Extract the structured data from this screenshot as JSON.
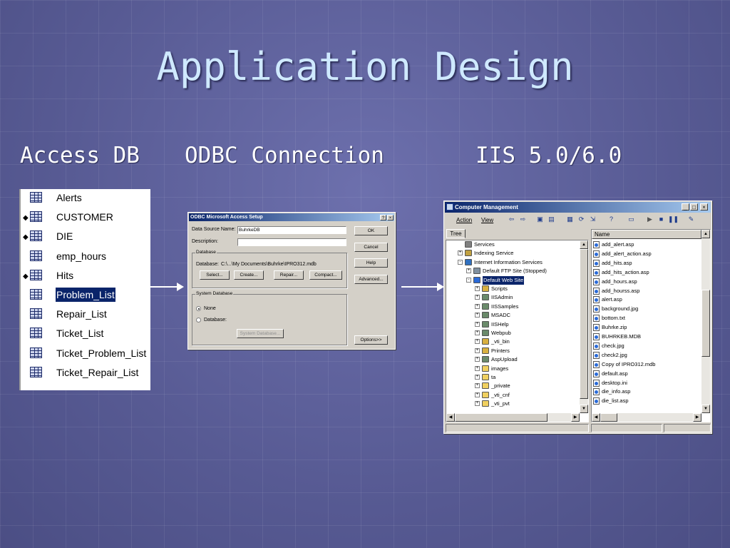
{
  "slide": {
    "title": "Application Design",
    "label_access": "Access DB",
    "label_odbc": "ODBC Connection",
    "label_iis": "IIS 5.0/6.0"
  },
  "access_tables": [
    {
      "name": "Alerts",
      "key": false,
      "selected": false
    },
    {
      "name": "CUSTOMER",
      "key": true,
      "selected": false
    },
    {
      "name": "DIE",
      "key": true,
      "selected": false
    },
    {
      "name": "emp_hours",
      "key": false,
      "selected": false
    },
    {
      "name": "Hits",
      "key": true,
      "selected": false
    },
    {
      "name": "Problem_List",
      "key": false,
      "selected": true
    },
    {
      "name": "Repair_List",
      "key": false,
      "selected": false
    },
    {
      "name": "Ticket_List",
      "key": false,
      "selected": false
    },
    {
      "name": "Ticket_Problem_List",
      "key": false,
      "selected": false
    },
    {
      "name": "Ticket_Repair_List",
      "key": false,
      "selected": false
    }
  ],
  "odbc": {
    "title": "ODBC Microsoft Access Setup",
    "help_btn": "?",
    "close_btn": "×",
    "dsn_label": "Data Source Name:",
    "dsn_value": "BuhrkeDB",
    "desc_label": "Description:",
    "desc_value": "",
    "db_group": "Database",
    "db_path_label": "Database:",
    "db_path": "C:\\...\\My Documents\\Buhrke\\IPRO312.mdb",
    "select": "Select...",
    "create": "Create...",
    "repair": "Repair...",
    "compact": "Compact...",
    "sysdb_group": "System Database",
    "none": "None",
    "database": "Database:",
    "sysdb_btn": "System Database...",
    "ok": "OK",
    "cancel": "Cancel",
    "help": "Help",
    "advanced": "Advanced...",
    "options": "Options>>"
  },
  "cm": {
    "title": "Computer Management",
    "menu_action": "Action",
    "menu_view": "View",
    "tab_tree": "Tree",
    "col_name": "Name",
    "tree": [
      {
        "text": "Services",
        "indent": 1,
        "pm": "",
        "icon": "gear",
        "selected": false
      },
      {
        "text": "Indexing Service",
        "indent": 1,
        "pm": "+",
        "icon": "service",
        "selected": false
      },
      {
        "text": "Internet Information Services",
        "indent": 1,
        "pm": "-",
        "icon": "iis",
        "selected": false
      },
      {
        "text": "Default FTP Site (Stopped)",
        "indent": 2,
        "pm": "+",
        "icon": "ftp",
        "selected": false
      },
      {
        "text": "Default Web Site",
        "indent": 2,
        "pm": "-",
        "icon": "globe",
        "selected": true
      },
      {
        "text": "Scripts",
        "indent": 3,
        "pm": "+",
        "icon": "vdir",
        "selected": false
      },
      {
        "text": "IISAdmin",
        "indent": 3,
        "pm": "+",
        "icon": "app",
        "selected": false
      },
      {
        "text": "IISSamples",
        "indent": 3,
        "pm": "+",
        "icon": "app",
        "selected": false
      },
      {
        "text": "MSADC",
        "indent": 3,
        "pm": "+",
        "icon": "app",
        "selected": false
      },
      {
        "text": "IISHelp",
        "indent": 3,
        "pm": "+",
        "icon": "app",
        "selected": false
      },
      {
        "text": "Webpub",
        "indent": 3,
        "pm": "+",
        "icon": "app",
        "selected": false
      },
      {
        "text": "_vti_bin",
        "indent": 3,
        "pm": "+",
        "icon": "vdir",
        "selected": false
      },
      {
        "text": "Printers",
        "indent": 3,
        "pm": "+",
        "icon": "vdir",
        "selected": false
      },
      {
        "text": "AspUpload",
        "indent": 3,
        "pm": "+",
        "icon": "app",
        "selected": false
      },
      {
        "text": "images",
        "indent": 3,
        "pm": "+",
        "icon": "folder",
        "selected": false
      },
      {
        "text": "ta",
        "indent": 3,
        "pm": "+",
        "icon": "folder",
        "selected": false
      },
      {
        "text": "_private",
        "indent": 3,
        "pm": "+",
        "icon": "folder",
        "selected": false
      },
      {
        "text": "_vti_cnf",
        "indent": 3,
        "pm": "+",
        "icon": "folder",
        "selected": false
      },
      {
        "text": "_vti_pvt",
        "indent": 3,
        "pm": "+",
        "icon": "folder",
        "selected": false
      }
    ],
    "files": [
      "add_alert.asp",
      "add_alert_action.asp",
      "add_hits.asp",
      "add_hits_action.asp",
      "add_hours.asp",
      "add_hourss.asp",
      "alert.asp",
      "background.jpg",
      "bottom.txt",
      "Buhrke.zip",
      "BUHRKEB.MDB",
      "check.jpg",
      "check2.jpg",
      "Copy of IPRO312.mdb",
      "default.asp",
      "desktop.ini",
      "die_info.asp",
      "die_list.asp"
    ]
  }
}
